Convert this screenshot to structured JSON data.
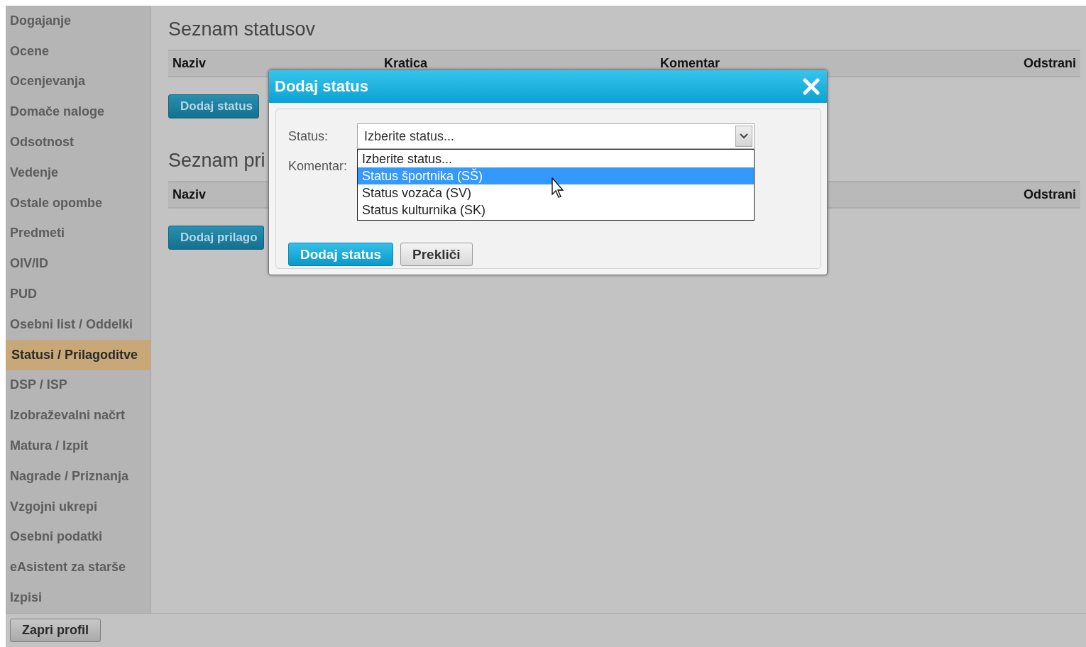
{
  "sidebar": {
    "items": [
      {
        "label": "Dogajanje",
        "selected": false
      },
      {
        "label": "Ocene",
        "selected": false
      },
      {
        "label": "Ocenjevanja",
        "selected": false
      },
      {
        "label": "Domače naloge",
        "selected": false
      },
      {
        "label": "Odsotnost",
        "selected": false
      },
      {
        "label": "Vedenje",
        "selected": false
      },
      {
        "label": "Ostale opombe",
        "selected": false
      },
      {
        "label": "Predmeti",
        "selected": false
      },
      {
        "label": "OIV/ID",
        "selected": false
      },
      {
        "label": "PUD",
        "selected": false
      },
      {
        "label": "Osebni list / Oddelki",
        "selected": false
      },
      {
        "label": "Statusi / Prilagoditve",
        "selected": true
      },
      {
        "label": "DSP / ISP",
        "selected": false
      },
      {
        "label": "Izobraževalni načrt",
        "selected": false
      },
      {
        "label": "Matura / Izpit",
        "selected": false
      },
      {
        "label": "Nagrade / Priznanja",
        "selected": false
      },
      {
        "label": "Vzgojni ukrepi",
        "selected": false
      },
      {
        "label": "Osebni podatki",
        "selected": false
      },
      {
        "label": "eAsistent za starše",
        "selected": false
      },
      {
        "label": "Izpisi",
        "selected": false
      }
    ]
  },
  "sections": [
    {
      "title": "Seznam statusov",
      "columns": [
        "Naziv",
        "Kratica",
        "Komentar",
        "Odstrani"
      ],
      "button": "Dodaj status"
    },
    {
      "title": "Seznam pri",
      "columns": [
        "Naziv",
        "Odstrani"
      ],
      "button": "Dodaj prilago"
    }
  ],
  "footer": {
    "button": "Zapri profil"
  },
  "dialog": {
    "title": "Dodaj status",
    "status_label": "Status:",
    "status_value": "Izberite status...",
    "comment_label": "Komentar:",
    "options": [
      {
        "label": "Izberite status...",
        "selected": false
      },
      {
        "label": "Status športnika (SŠ)",
        "selected": true
      },
      {
        "label": "Status vozača (SV)",
        "selected": false
      },
      {
        "label": "Status kulturnika (SK)",
        "selected": false
      }
    ],
    "buttons": [
      {
        "label": "Dodaj status",
        "kind": "primary"
      },
      {
        "label": "Prekliči",
        "kind": "secondary"
      }
    ]
  }
}
